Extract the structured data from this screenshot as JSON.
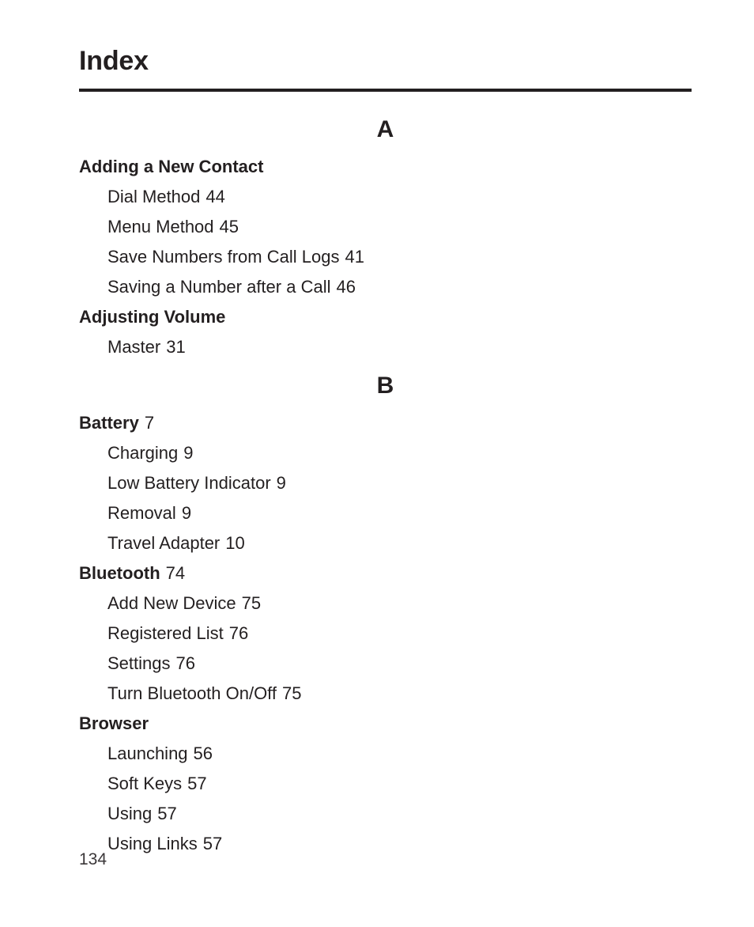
{
  "document": {
    "title": "Index",
    "page_number": "134",
    "text_color": "#231f20",
    "rule_color": "#231f20"
  },
  "sections": [
    {
      "letter": "A",
      "entries": [
        {
          "title": "Adding a New Contact",
          "page": "",
          "subentries": [
            {
              "title": "Dial Method",
              "page": "44"
            },
            {
              "title": "Menu Method",
              "page": "45"
            },
            {
              "title": "Save Numbers from Call Logs",
              "page": "41"
            },
            {
              "title": "Saving a Number after a Call",
              "page": "46"
            }
          ]
        },
        {
          "title": "Adjusting Volume",
          "page": "",
          "subentries": [
            {
              "title": "Master",
              "page": "31"
            }
          ]
        }
      ]
    },
    {
      "letter": "B",
      "entries": [
        {
          "title": "Battery",
          "page": "7",
          "subentries": [
            {
              "title": "Charging",
              "page": "9"
            },
            {
              "title": "Low Battery Indicator",
              "page": "9"
            },
            {
              "title": "Removal",
              "page": "9"
            },
            {
              "title": "Travel Adapter",
              "page": "10"
            }
          ]
        },
        {
          "title": "Bluetooth",
          "page": "74",
          "subentries": [
            {
              "title": "Add New Device",
              "page": "75"
            },
            {
              "title": "Registered List",
              "page": "76"
            },
            {
              "title": "Settings",
              "page": "76"
            },
            {
              "title": "Turn Bluetooth On/Off",
              "page": "75"
            }
          ]
        },
        {
          "title": "Browser",
          "page": "",
          "subentries": [
            {
              "title": "Launching",
              "page": "56"
            },
            {
              "title": "Soft Keys",
              "page": "57"
            },
            {
              "title": "Using",
              "page": "57"
            },
            {
              "title": "Using Links",
              "page": "57"
            }
          ]
        }
      ]
    }
  ]
}
